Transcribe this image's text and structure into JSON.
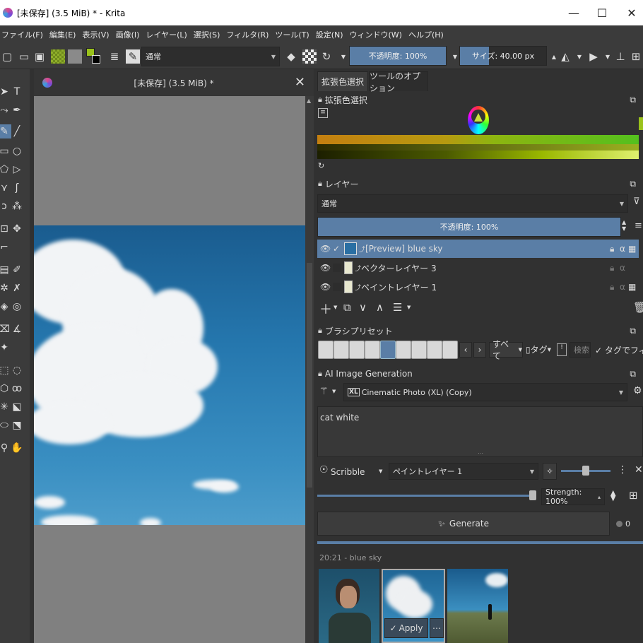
{
  "window": {
    "title": "[未保存]  (3.5 MiB) * - Krita"
  },
  "menu": [
    "ファイル(F)",
    "編集(E)",
    "表示(V)",
    "画像(I)",
    "レイヤー(L)",
    "選択(S)",
    "フィルタ(R)",
    "ツール(T)",
    "設定(N)",
    "ウィンドウ(W)",
    "ヘルプ(H)"
  ],
  "toolbar": {
    "blend_mode": "通常",
    "opacity": "不透明度: 100%",
    "size": "サイズ: 40.00 px",
    "opacity_level": 1.0
  },
  "document": {
    "tab_title": "[未保存]  (3.5 MiB) *"
  },
  "tabs": {
    "color_selector": "拡張色選択",
    "tool_options": "ツールのオプション"
  },
  "color_panel": {
    "title": "拡張色選択"
  },
  "layers": {
    "title": "レイヤー",
    "blend_mode": "通常",
    "opacity": "不透明度: 100%",
    "items": [
      {
        "name": "[Preview] blue sky",
        "selected": true
      },
      {
        "name": "ベクターレイヤー 3",
        "selected": false
      },
      {
        "name": "ペイントレイヤー 1",
        "selected": false
      }
    ]
  },
  "brush_presets": {
    "title": "ブラシプリセット",
    "filter": "すべて",
    "tag": "タグ",
    "search_placeholder": "検索",
    "tag_filter": "タグでフィルタ"
  },
  "ai": {
    "title": "AI Image Generation",
    "style": "Cinematic Photo (XL) (Copy)",
    "style_badge": "XL",
    "prompt": "cat white",
    "mode": "Scribble",
    "control_layer": "ペイントレイヤー 1",
    "strength": "Strength: 100%",
    "generate": "Generate",
    "queue_count": "0",
    "history_label": "20:21 - blue sky",
    "apply": "Apply"
  }
}
